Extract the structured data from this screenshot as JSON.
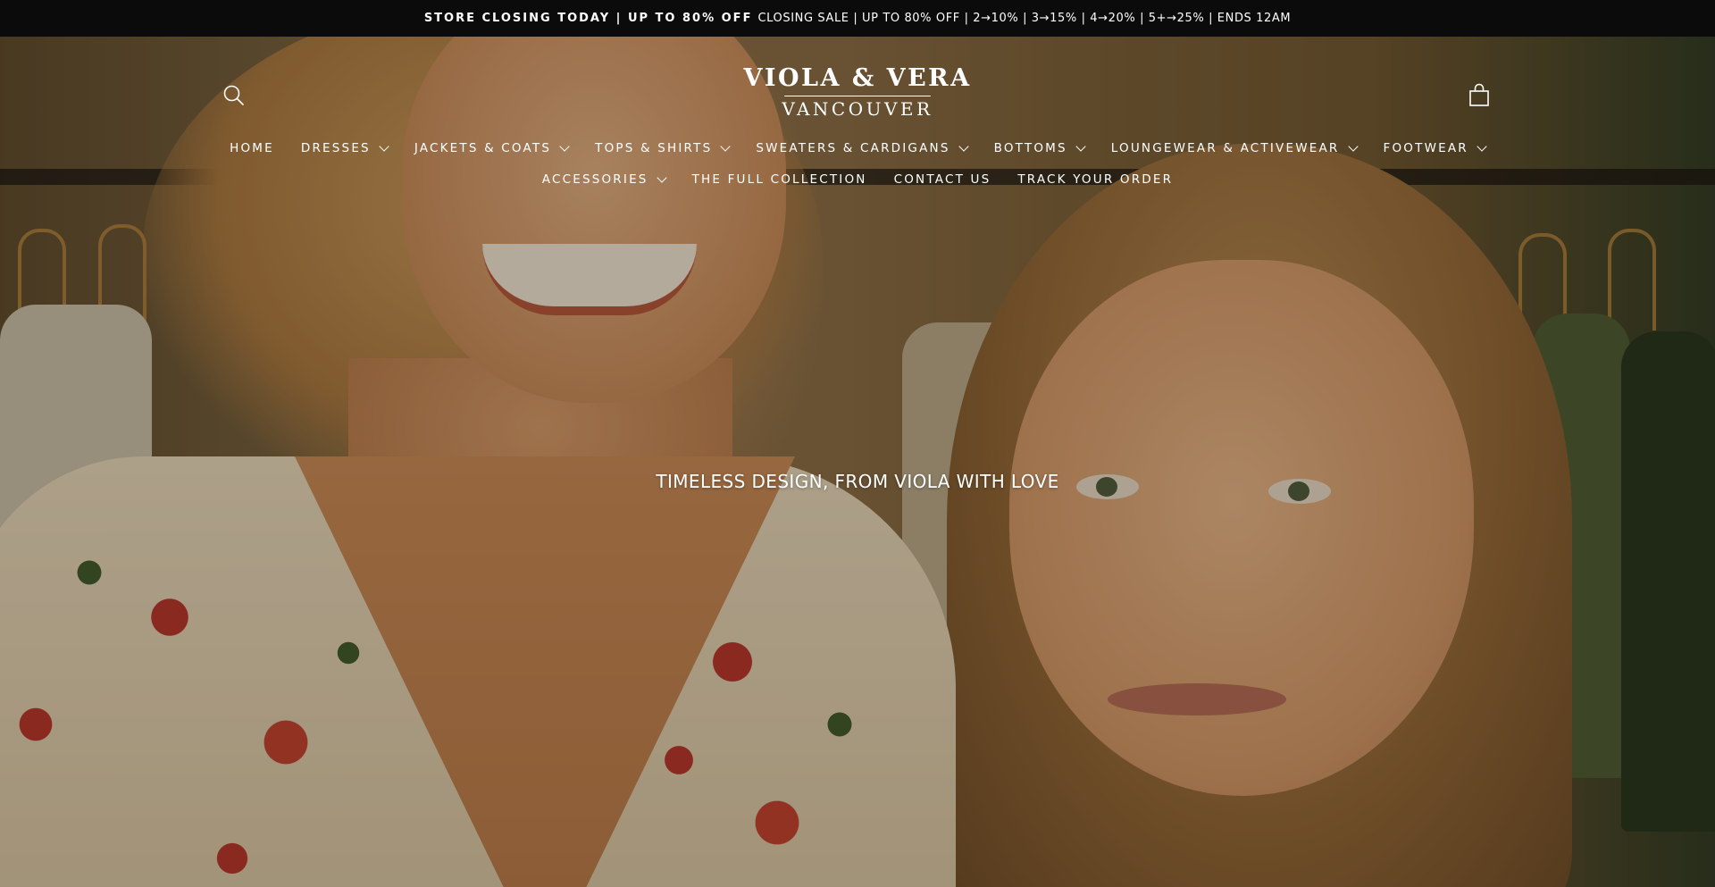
{
  "announcement": {
    "bold": "STORE CLOSING TODAY | UP TO 80% OFF",
    "text": "CLOSING SALE | UP TO 80% OFF | 2→10% | 3→15% | 4→20% | 5+→25% | ENDS 12AM"
  },
  "header": {
    "logo_main": "VIOLA & VERA",
    "logo_sub": "VANCOUVER",
    "search_icon": "search-icon",
    "cart_icon": "shopping-bag-icon"
  },
  "nav": {
    "row1": [
      {
        "label": "HOME",
        "dropdown": false
      },
      {
        "label": "DRESSES",
        "dropdown": true
      },
      {
        "label": "JACKETS & COATS",
        "dropdown": true
      },
      {
        "label": "TOPS & SHIRTS",
        "dropdown": true
      },
      {
        "label": "SWEATERS & CARDIGANS",
        "dropdown": true
      },
      {
        "label": "BOTTOMS",
        "dropdown": true
      },
      {
        "label": "LOUNGEWEAR & ACTIVEWEAR",
        "dropdown": true
      },
      {
        "label": "FOOTWEAR",
        "dropdown": true
      }
    ],
    "row2": [
      {
        "label": "ACCESSORIES",
        "dropdown": true
      },
      {
        "label": "THE FULL COLLECTION",
        "dropdown": false
      },
      {
        "label": "CONTACT US",
        "dropdown": false
      },
      {
        "label": "TRACK YOUR ORDER",
        "dropdown": false
      }
    ]
  },
  "hero": {
    "tagline": "TIMELESS DESIGN, FROM VIOLA WITH LOVE"
  },
  "colors": {
    "announcement_bg": "#0b0b0b",
    "text": "#ffffff"
  }
}
